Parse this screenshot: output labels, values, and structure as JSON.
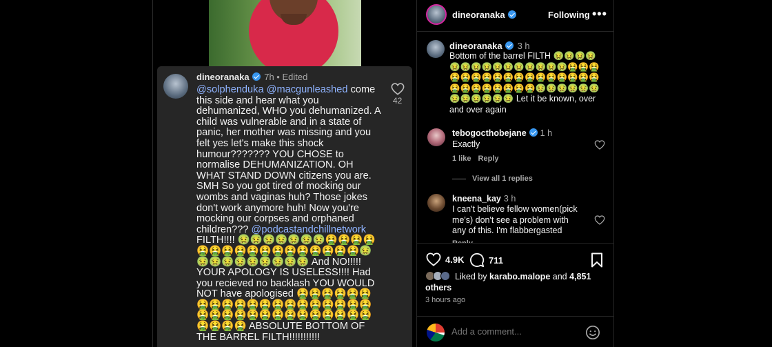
{
  "screenshot_comment": {
    "username": "dineoranaka",
    "meta": "7h • Edited",
    "mentions": [
      "@solphenduka",
      "@macgunleashed"
    ],
    "text_1": " come this side and hear what you dehumanized, WHO you dehumanized. A child was vulnerable and in a state of panic, her mother was missing and you felt yes let's make this shock humour??????? YOU CHOSE to normalise DEHUMANIZATION. OH WHAT STAND DOWN citizens you are. SMH So you got tired of mocking our wombs and vaginas huh? Those jokes don't work anymore huh! Now you're mocking our corpses and orphaned children??? ",
    "mention_2": "@podcastandchillnetwork",
    "text_2": " FILTH!!!! 🤢🤢🤢🤢🤢🤢🤢🤮🤮🤮🤮🤮🤮🤮🤮🤮🤮🤮🤮🤮🤮🤮🤮🤮🤢🤢🤢🤢🤢🤢🤢🤢🤢🤢 And NO!!!!! YOUR APOLOGY IS USELESS!!!! Had you recieved no backlash YOU WOULD NOT have apologised 🤮🤮🤮🤮🤮🤮🤮🤮🤮🤮🤮🤮🤮🤮🤮🤮🤮🤮🤮🤮🤮🤮🤮🤮🤮🤮🤮🤮🤮🤮🤮🤮🤮🤮🤮🤮🤮🤮 ABSOLUTE BOTTOM OF THE BARREL FILTH!!!!!!!!!!!",
    "likes": "42"
  },
  "header": {
    "username": "dineoranaka",
    "follow_label": "Following",
    "more_label": "•••"
  },
  "caption": {
    "username": "dineoranaka",
    "time": "3 h",
    "text": "Bottom of the barrel FILTH 🤢🤢🤢🤢🤢🤢🤢🤢🤢🤢🤢🤢🤢🤢🤢🤮🤮🤮🤮🤮🤮🤮🤮🤮🤮🤮🤮🤮🤮🤮🤮🤮🤮🤮🤮🤮🤮🤮🤮🤮🤢🤢🤢🤢🤢🤢🤢🤢🤢🤢🤢🤢 Let it be known, over and over again"
  },
  "comments": [
    {
      "username": "tebogocthobejane",
      "time": "1 h",
      "text": "Exactly",
      "likes_label": "1 like",
      "reply_label": "Reply",
      "view_replies": "View all 1 replies"
    },
    {
      "username": "kneena_kay",
      "time": "3 h",
      "text": "I can't believe fellow women(pick me's) don't see a problem with any of this. I'm flabbergasted",
      "reply_label": "Reply"
    }
  ],
  "actions": {
    "likes_count": "4.9K",
    "comments_count": "711"
  },
  "liked_by": {
    "prefix": "Liked by",
    "user": "karabo.malope",
    "middle": "and",
    "others": "4,851 others"
  },
  "time_ago": "3 hours ago",
  "add_comment": {
    "placeholder": "Add a comment..."
  }
}
